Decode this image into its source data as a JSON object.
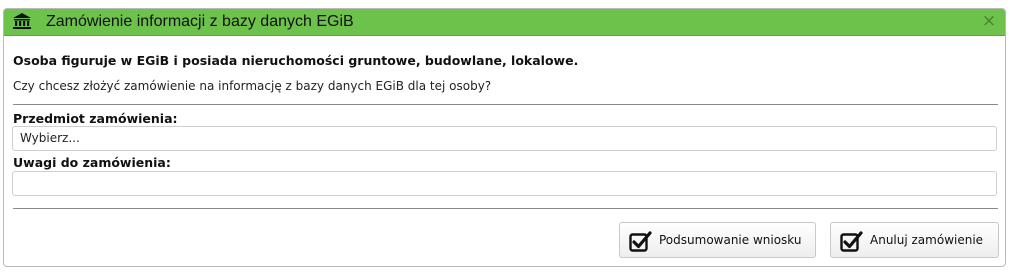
{
  "dialog": {
    "title": "Zamówienie informacji z bazy danych EGiB",
    "title_icon": "bank-building-icon",
    "close_glyph": "×"
  },
  "message": {
    "headline": "Osoba figuruje  w EGiB i posiada nieruchomości gruntowe, budowlane, lokalowe.",
    "question": "Czy chcesz złożyć zamówienie na informację z bazy danych EGiB dla tej osoby?"
  },
  "form": {
    "subject_label": "Przedmiot zamówienia:",
    "subject_value": "Wybierz...",
    "notes_label": "Uwagi do zamówienia:",
    "notes_value": ""
  },
  "buttons": {
    "summary_label": "Podsumowanie wniosku",
    "cancel_label": "Anuluj zamówienie",
    "icon": "checkbox-checked-icon"
  },
  "colors": {
    "titlebar": "#6cc24a",
    "close": "#4c7f35"
  }
}
